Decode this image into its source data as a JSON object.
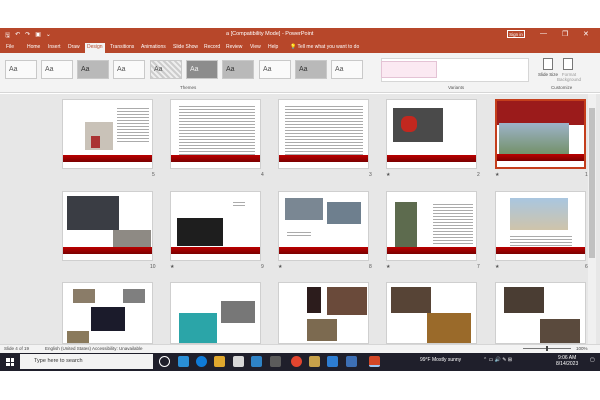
{
  "window": {
    "title": "a [Compatibility Mode] - PowerPoint",
    "sign_in": "Sign in",
    "minimize": "—",
    "restore": "❐",
    "close": "✕"
  },
  "qat": {
    "save": "🖫",
    "undo": "↶",
    "redo": "↷",
    "present": "▣",
    "more": "⌄"
  },
  "tabs": [
    "File",
    "Home",
    "Insert",
    "Draw",
    "Design",
    "Transitions",
    "Animations",
    "Slide Show",
    "Record",
    "Review",
    "View",
    "Help"
  ],
  "active_tab": "Design",
  "tell_me": "Tell me what you want to do",
  "ribbon": {
    "themes_label": "Themes",
    "variants_label": "Variants",
    "customize_label": "Customize",
    "theme_preview_text": "Aa",
    "slide_size": "Slide Size",
    "format_background": "Format Background"
  },
  "slides_row1": [
    {
      "num": "5",
      "star": ""
    },
    {
      "num": "4",
      "star": ""
    },
    {
      "num": "3",
      "star": ""
    },
    {
      "num": "2",
      "star": "★"
    },
    {
      "num": "1",
      "star": "★"
    }
  ],
  "slides_row2": [
    {
      "num": "10",
      "star": ""
    },
    {
      "num": "9",
      "star": "★"
    },
    {
      "num": "8",
      "star": "★"
    },
    {
      "num": "7",
      "star": "★"
    },
    {
      "num": "6",
      "star": "★"
    }
  ],
  "status": {
    "slide_count": "Slide 4 of 19",
    "language": "English (United States)",
    "accessibility": "Accessibility: Unavailable",
    "zoom": "100%"
  },
  "taskbar": {
    "search_placeholder": "Type here to search",
    "weather": "99°F  Mostly sunny",
    "time": "9:06 AM",
    "date": "8/14/2023"
  },
  "colors": {
    "accent": "#b7472a",
    "taskbar": "#1f1f2b",
    "slide_band": "#a00000"
  }
}
